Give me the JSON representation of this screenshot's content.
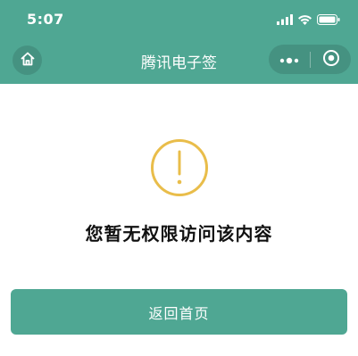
{
  "status_bar": {
    "time": "5:07",
    "signal_icon": "signal-bars-icon",
    "wifi_icon": "wifi-icon",
    "battery_icon": "battery-icon"
  },
  "nav": {
    "title": "腾讯电子签",
    "home_icon": "home-icon",
    "more_icon": "more-dots-icon",
    "close_icon": "target-close-icon"
  },
  "content": {
    "alert_icon": "exclamation-circle-icon",
    "message": "您暂无权限访问该内容",
    "back_button_label": "返回首页"
  },
  "colors": {
    "primary": "#4fa793",
    "warning": "#e9bd4a",
    "text": "#111111"
  }
}
